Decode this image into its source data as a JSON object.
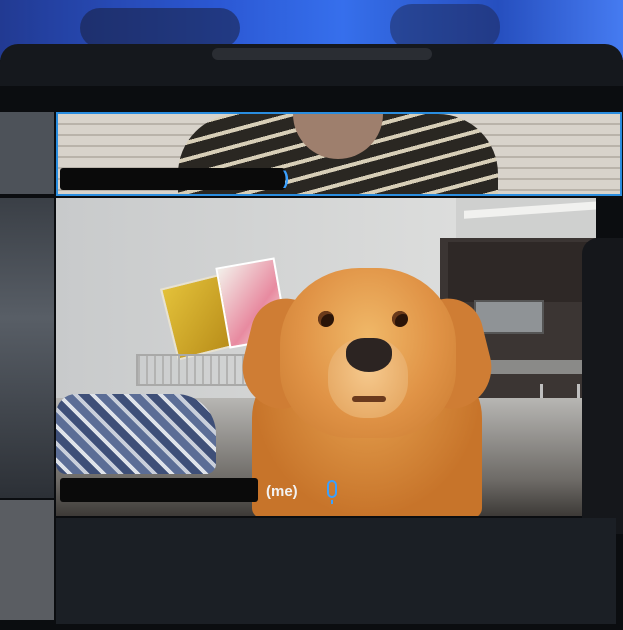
{
  "meeting": {
    "top_participant": {
      "name_redacted": true,
      "speaking_indicator": "speaker-icon",
      "active_speaker_border_color": "#2a8ddf"
    },
    "main_participant": {
      "name_redacted": true,
      "self_label": "(me)",
      "mic_icon": "microphone-icon",
      "mic_color": "#3aa0ff"
    }
  }
}
